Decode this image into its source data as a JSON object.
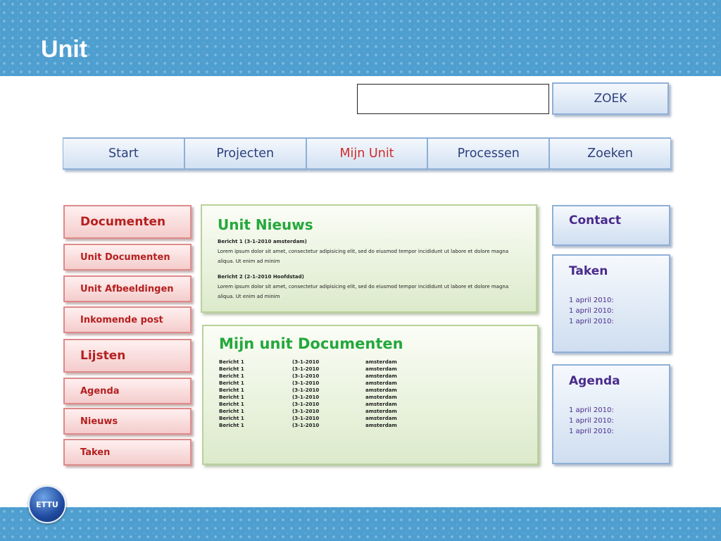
{
  "title": "Unit",
  "search": {
    "value": "",
    "button_label": "ZOEK"
  },
  "nav": [
    {
      "label": "Start",
      "active": false
    },
    {
      "label": "Projecten",
      "active": false
    },
    {
      "label": "Mijn Unit",
      "active": true
    },
    {
      "label": "Processen",
      "active": false
    },
    {
      "label": "Zoeken",
      "active": false
    }
  ],
  "left_menu": [
    {
      "label": "Documenten",
      "type": "heading"
    },
    {
      "label": "Unit Documenten",
      "type": "item"
    },
    {
      "label": "Unit Afbeeldingen",
      "type": "item"
    },
    {
      "label": "Inkomende post",
      "type": "item"
    },
    {
      "label": "Lijsten",
      "type": "heading"
    },
    {
      "label": "Agenda",
      "type": "item"
    },
    {
      "label": "Nieuws",
      "type": "item"
    },
    {
      "label": "Taken",
      "type": "item"
    }
  ],
  "news": {
    "title": "Unit Nieuws",
    "items": [
      {
        "heading": "Bericht 1 (3-1-2010 amsterdam)",
        "body": "Lorem ipsum dolor sit amet, consectetur adipisicing elit, sed do eiusmod tempor incididunt ut labore et dolore magna aliqua. Ut enim ad minim"
      },
      {
        "heading": "Bericht 2 (2-1-2010 Hoofdstad)",
        "body": "Lorem ipsum dolor sit amet, consectetur adipisicing elit, sed do eiusmod tempor incididunt ut labore et dolore magna aliqua. Ut enim ad minim"
      }
    ]
  },
  "docs": {
    "title": "Mijn unit Documenten",
    "rows": [
      {
        "name": "Bericht 1",
        "date": "(3-1-2010",
        "place": "amsterdam"
      },
      {
        "name": "Bericht 1",
        "date": "(3-1-2010",
        "place": "amsterdam"
      },
      {
        "name": "Bericht 1",
        "date": "(3-1-2010",
        "place": "amsterdam"
      },
      {
        "name": "Bericht 1",
        "date": "(3-1-2010",
        "place": "amsterdam"
      },
      {
        "name": "Bericht 1",
        "date": "(3-1-2010",
        "place": "amsterdam"
      },
      {
        "name": "Bericht 1",
        "date": "(3-1-2010",
        "place": "amsterdam"
      },
      {
        "name": "Bericht 1",
        "date": "(3-1-2010",
        "place": "amsterdam"
      },
      {
        "name": "Bericht 1",
        "date": "(3-1-2010",
        "place": "amsterdam"
      },
      {
        "name": "Bericht 1",
        "date": "(3-1-2010",
        "place": "amsterdam"
      },
      {
        "name": "Bericht 1",
        "date": "(3-1-2010",
        "place": "amsterdam"
      }
    ]
  },
  "contact": {
    "title": "Contact"
  },
  "taken": {
    "title": "Taken",
    "dates": [
      "1 april 2010:",
      "1 april 2010:",
      "1 april 2010:"
    ]
  },
  "agenda": {
    "title": "Agenda",
    "dates": [
      "1 april 2010:",
      "1 april 2010:",
      "1 april 2010:"
    ]
  },
  "logo": {
    "text": "ETTU"
  },
  "colors": {
    "header_band": "#4e9fd0",
    "nav_active": "#d32a2a",
    "left_menu_text": "#b52020",
    "panel_title_green": "#24a83c",
    "right_panel_text": "#4a2b8c"
  }
}
